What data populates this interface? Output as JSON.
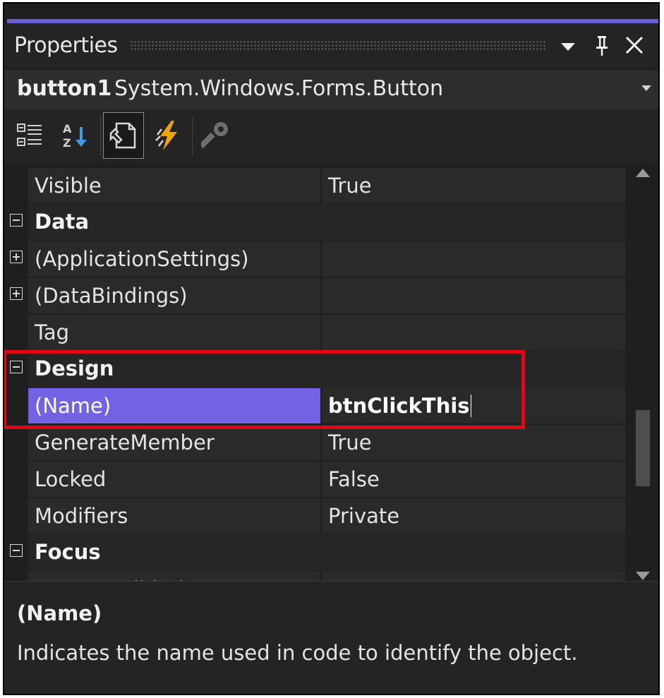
{
  "window": {
    "title": "Properties",
    "dropdown_icon": "chevron-down-icon",
    "pin_icon": "pin-icon",
    "close_icon": "close-icon",
    "accent_color": "#6b5fd6"
  },
  "object_selector": {
    "name": "button1",
    "type": "System.Windows.Forms.Button"
  },
  "toolbar": {
    "buttons": [
      {
        "icon": "categorized-icon",
        "active": false
      },
      {
        "icon": "alphabetical-icon",
        "active": false
      },
      {
        "icon": "properties-icon",
        "active": true
      },
      {
        "icon": "events-icon",
        "active": false
      },
      {
        "icon": "property-pages-icon",
        "active": false
      }
    ]
  },
  "grid": {
    "rows": [
      {
        "kind": "prop",
        "name": "Visible",
        "value": "True"
      },
      {
        "kind": "category",
        "name": "Data",
        "expanded": true
      },
      {
        "kind": "prop",
        "name": "(ApplicationSettings)",
        "value": "",
        "expandable": true
      },
      {
        "kind": "prop",
        "name": "(DataBindings)",
        "value": "",
        "expandable": true
      },
      {
        "kind": "prop",
        "name": "Tag",
        "value": ""
      },
      {
        "kind": "category",
        "name": "Design",
        "expanded": true
      },
      {
        "kind": "prop",
        "name": "(Name)",
        "value": "btnClickThis",
        "selected": true
      },
      {
        "kind": "prop",
        "name": "GenerateMember",
        "value": "True"
      },
      {
        "kind": "prop",
        "name": "Locked",
        "value": "False"
      },
      {
        "kind": "prop",
        "name": "Modifiers",
        "value": "Private"
      },
      {
        "kind": "category",
        "name": "Focus",
        "expanded": true
      },
      {
        "kind": "prop",
        "name": "CausesValidation",
        "value": "True"
      }
    ],
    "selection_color": "#7163e3",
    "highlight_color": "#e30613"
  },
  "description": {
    "title": "(Name)",
    "text": "Indicates the name used in code to identify the object."
  }
}
